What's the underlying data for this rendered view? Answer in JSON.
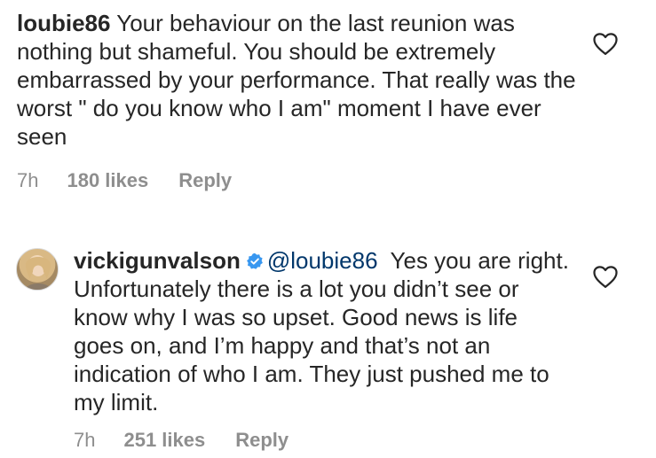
{
  "comments": [
    {
      "username": "loubie86",
      "mention": "",
      "text": "Your behaviour on the last reunion was nothing but shameful. You should be extremely embarrassed by your performance. That really was the worst \" do you know who I am\" moment I have ever seen",
      "time": "7h",
      "likes": "180 likes",
      "reply": "Reply",
      "verified": false,
      "has_avatar": false,
      "icon": "heart-outline-icon"
    },
    {
      "username": "vickigunvalson",
      "mention": "@loubie86",
      "text": "Yes you are right.  Unfortunately there is a lot you didn’t see or know why I was so upset. Good news is life goes on, and I’m happy and that’s not an indication of who I am. They just pushed me to my limit.",
      "time": "7h",
      "likes": "251 likes",
      "reply": "Reply",
      "verified": true,
      "has_avatar": true,
      "icon": "heart-outline-icon"
    }
  ],
  "colors": {
    "text": "#262626",
    "meta": "#8e8e8e",
    "mention": "#00376b",
    "verified": "#3897f0"
  }
}
